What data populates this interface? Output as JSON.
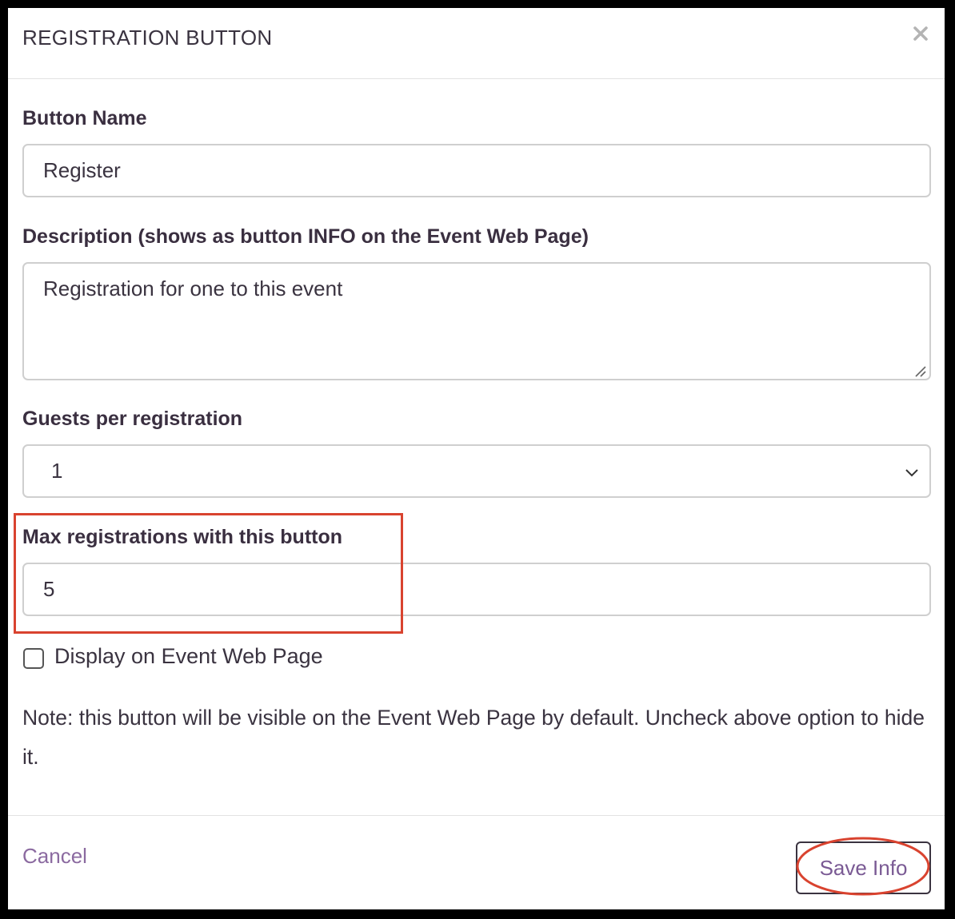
{
  "dialog": {
    "title": "REGISTRATION BUTTON",
    "close_icon": "close-icon"
  },
  "form": {
    "button_name": {
      "label": "Button Name",
      "value": "Register"
    },
    "description": {
      "label": "Description (shows as button INFO on the Event Web Page)",
      "value": "Registration for one to this event"
    },
    "guests_per_registration": {
      "label": "Guests per registration",
      "selected": "1"
    },
    "max_registrations": {
      "label": "Max registrations with this button",
      "value": "5"
    },
    "display_on_page": {
      "label": "Display on Event Web Page",
      "checked": false
    },
    "note": "Note: this button will be visible on the Event Web Page by default. Uncheck above option to hide it."
  },
  "footer": {
    "cancel_label": "Cancel",
    "save_label": "Save Info"
  },
  "colors": {
    "accent": "#8b6aa0",
    "annotation": "#d9432f",
    "text": "#3a3340"
  }
}
